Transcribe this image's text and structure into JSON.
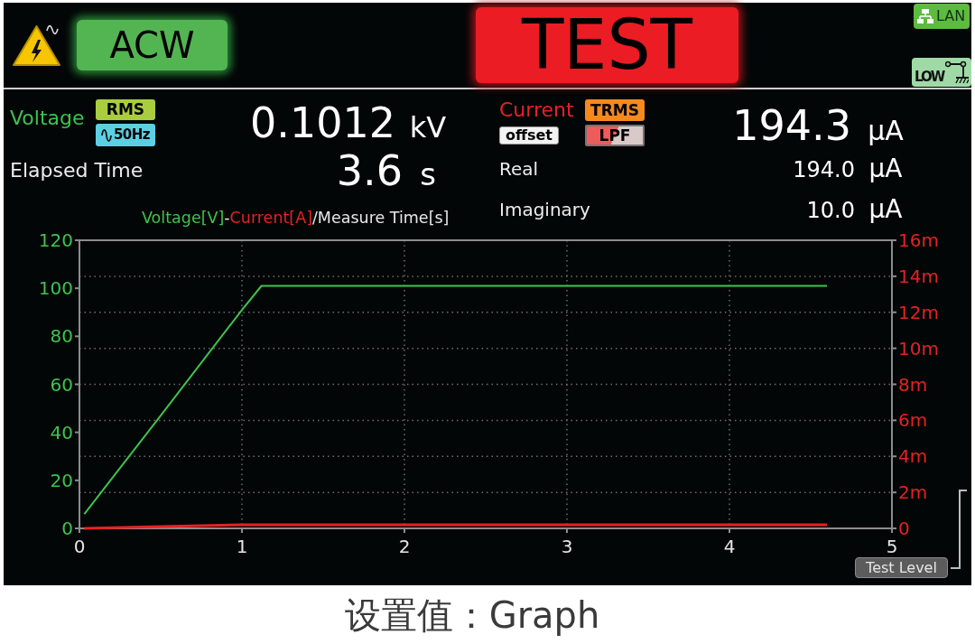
{
  "header": {
    "mode": "ACW",
    "status": "TEST",
    "indicators": [
      {
        "kind": "lan",
        "label": "LAN"
      },
      {
        "kind": "low",
        "label": "LOW"
      }
    ]
  },
  "voltage": {
    "label": "Voltage",
    "badges": [
      {
        "kind": "rms",
        "label": "RMS"
      },
      {
        "kind": "frequency",
        "label": "50Hz"
      }
    ],
    "value": "0.1012",
    "unit": "kV"
  },
  "elapsed_time": {
    "label": "Elapsed Time",
    "value": "3.6",
    "unit": "s"
  },
  "current": {
    "label": "Current",
    "badges": [
      {
        "kind": "trms",
        "label": "TRMS"
      },
      {
        "kind": "offset",
        "label": "offset"
      },
      {
        "kind": "lpf",
        "label": "LPF"
      }
    ],
    "value": "194.3",
    "unit": "μA"
  },
  "components": [
    {
      "label": "Real",
      "value": "194.0",
      "unit": "μA"
    },
    {
      "label": "Imaginary",
      "value": "10.0",
      "unit": "μA"
    }
  ],
  "graph": {
    "heading": [
      {
        "kind": "series"
      },
      {
        "kind": "text",
        "text": "-"
      },
      {
        "kind": "series"
      },
      {
        "kind": "text",
        "text": "/Measure Time[s]"
      }
    ],
    "chart_data": {
      "type": "line",
      "x": [
        0.03,
        0.5,
        1.0,
        1.12,
        2,
        3,
        4,
        4.6
      ],
      "series": [
        {
          "name": "Voltage[V]",
          "color": "#3cc44c",
          "values": [
            6,
            47,
            91,
            101,
            101,
            101,
            101,
            101
          ]
        },
        {
          "name": "Current[A]",
          "color": "#e52222",
          "axis": "y2",
          "values": [
            0,
            0.1,
            0.2,
            0.2,
            0.2,
            0.2,
            0.2,
            0.2
          ]
        }
      ],
      "xlim": [
        0,
        5
      ],
      "ylim": [
        0,
        120
      ],
      "xticks": [
        0,
        1,
        2,
        3,
        4,
        5
      ],
      "yticks": [
        0,
        20,
        40,
        60,
        80,
        100,
        120
      ],
      "y2lim": [
        0,
        16
      ],
      "y2ticks": [
        {
          "value": 0,
          "label": "0"
        },
        {
          "value": 2,
          "label": "2m"
        },
        {
          "value": 4,
          "label": "4m"
        },
        {
          "value": 6,
          "label": "6m"
        },
        {
          "value": 8,
          "label": "8m"
        },
        {
          "value": 10,
          "label": "10m"
        },
        {
          "value": 12,
          "label": "12m"
        },
        {
          "value": 14,
          "label": "14m"
        },
        {
          "value": 16,
          "label": "16m"
        }
      ],
      "grid": true
    },
    "test_level_button": "Test Level"
  },
  "caption": "设置值：Graph"
}
